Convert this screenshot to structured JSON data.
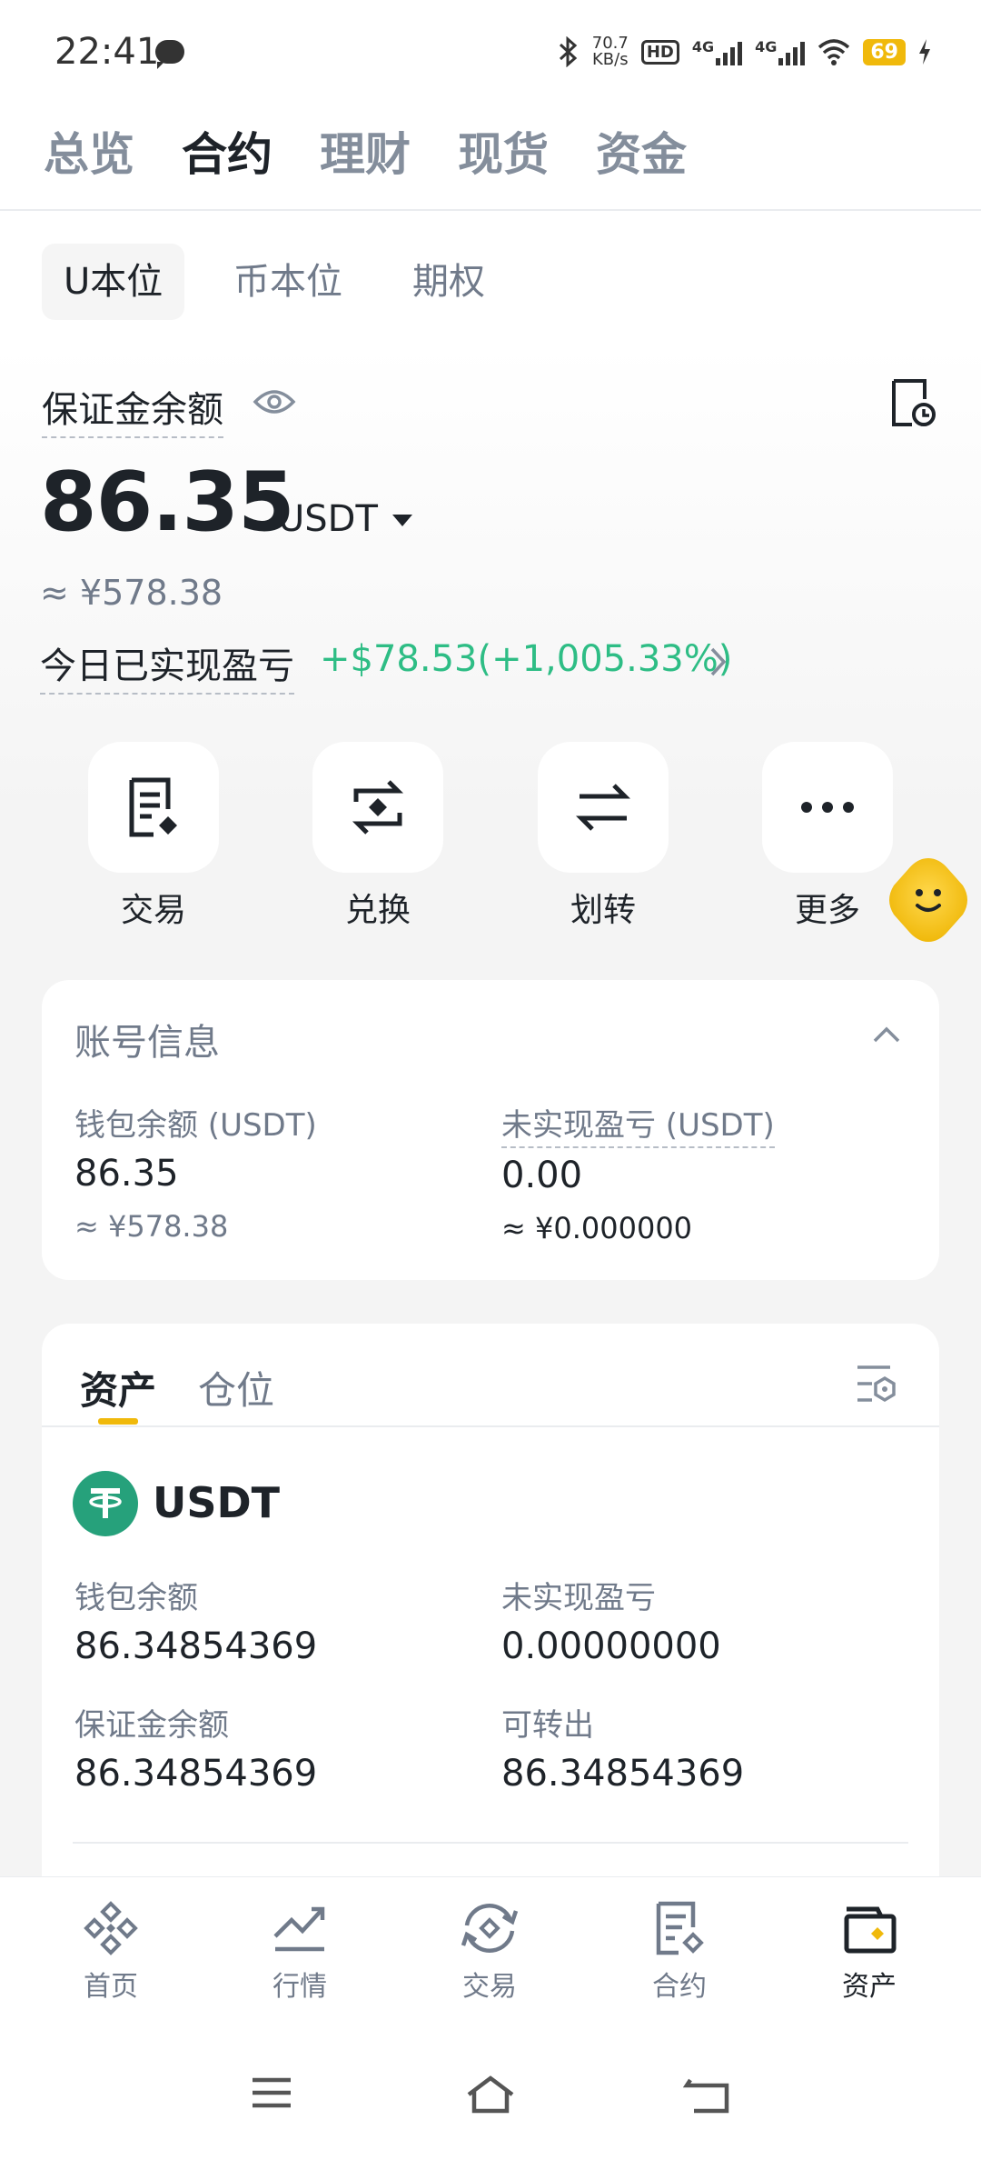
{
  "status_bar": {
    "time": "22:41",
    "net_speed_value": "70.7",
    "net_speed_unit": "KB/s",
    "hd_label": "HD",
    "sim1_label": "4G",
    "sim2_label": "4G",
    "battery": "69"
  },
  "top_tabs": [
    {
      "label": "总览",
      "active": false
    },
    {
      "label": "合约",
      "active": true
    },
    {
      "label": "理财",
      "active": false
    },
    {
      "label": "现货",
      "active": false
    },
    {
      "label": "资金",
      "active": false
    }
  ],
  "sub_tabs": [
    {
      "label": "U本位",
      "active": true
    },
    {
      "label": "币本位",
      "active": false
    },
    {
      "label": "期权",
      "active": false
    }
  ],
  "balance": {
    "label": "保证金余额",
    "amount": "86.35",
    "unit": "USDT",
    "approx_cny": "≈ ¥578.38",
    "pnl_label": "今日已实现盈亏",
    "pnl_value": "+$78.53(+1,005.33%)"
  },
  "quick_actions": [
    {
      "label": "交易",
      "icon": "trade-doc-icon"
    },
    {
      "label": "兑换",
      "icon": "convert-icon"
    },
    {
      "label": "划转",
      "icon": "transfer-icon"
    },
    {
      "label": "更多",
      "icon": "more-icon"
    }
  ],
  "account_info": {
    "title": "账号信息",
    "wallet_label": "钱包余额 (USDT)",
    "wallet_value": "86.35",
    "wallet_cny": "≈ ¥578.38",
    "unrealized_label": "未实现盈亏 (USDT)",
    "unrealized_value": "0.00",
    "unrealized_cny": "≈ ¥0.000000"
  },
  "assets": {
    "tabs": [
      {
        "label": "资产",
        "active": true
      },
      {
        "label": "仓位",
        "active": false
      }
    ],
    "coin": "USDT",
    "wallet_label": "钱包余额",
    "wallet_value": "86.34854369",
    "unrealized_label": "未实现盈亏",
    "unrealized_value": "0.00000000",
    "margin_label": "保证金余额",
    "margin_value": "86.34854369",
    "transferable_label": "可转出",
    "transferable_value": "86.34854369"
  },
  "bottom_nav": [
    {
      "label": "首页",
      "icon": "home-diamond-icon",
      "active": false
    },
    {
      "label": "行情",
      "icon": "market-chart-icon",
      "active": false
    },
    {
      "label": "交易",
      "icon": "trade-swap-icon",
      "active": false
    },
    {
      "label": "合约",
      "icon": "futures-doc-icon",
      "active": false
    },
    {
      "label": "资产",
      "icon": "wallet-icon",
      "active": true
    }
  ],
  "colors": {
    "brand_yellow": "#f0b90b",
    "positive_green": "#2ebd85",
    "text_primary": "#1e2329",
    "text_secondary": "#707a8a",
    "usdt_green": "#26a17b"
  }
}
